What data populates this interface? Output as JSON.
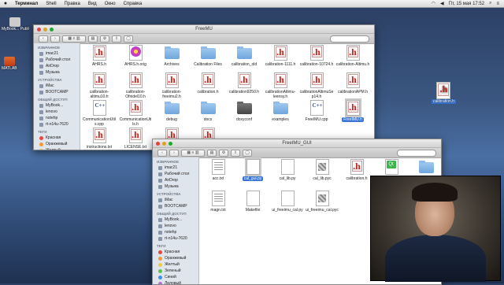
{
  "menubar": {
    "apple": "",
    "items": [
      "Терминал",
      "Shell",
      "Правка",
      "Вид",
      "Окно",
      "Справка"
    ],
    "clock": "Пт, 15 мая  17:52"
  },
  "desktop": {
    "icons": [
      {
        "label": "MyBook... Publi",
        "icon": "drive-icon"
      },
      {
        "label": "MATLAB",
        "icon": "app-icon"
      },
      {
        "label": "calibration.h",
        "icon": "h-file-icon"
      }
    ]
  },
  "window1": {
    "title": "FreeMU",
    "sidebar": {
      "sections": [
        {
          "header": "ИЗБРАННОЕ",
          "items": [
            "imac21",
            "Рабочий стол",
            "AirDrop",
            "Музыка"
          ]
        },
        {
          "header": "УСТРОЙСТВА",
          "items": [
            "iMac",
            "BOOTCAMP"
          ]
        },
        {
          "header": "ОБЩИЙ ДОСТУП",
          "items": [
            "MyBook... ",
            "lenovo",
            "notehp",
            "rt-n14u-7620"
          ]
        },
        {
          "header": "ТЕГИ",
          "items": [
            "Красная",
            "Оранжевый",
            "Желтый"
          ]
        }
      ]
    },
    "files": [
      {
        "name": "AHRS.h",
        "kind": "h"
      },
      {
        "name": "AHRS.h.orig",
        "kind": "flower"
      },
      {
        "name": "Archives",
        "kind": "folder"
      },
      {
        "name": "Calibration Files",
        "kind": "folder"
      },
      {
        "name": "calibration_old",
        "kind": "folder"
      },
      {
        "name": "calibration-1111.h",
        "kind": "h"
      },
      {
        "name": "calibration-10724.h",
        "kind": "h"
      },
      {
        "name": "calibration-Altimu.h",
        "kind": "h"
      },
      {
        "name": "calibration-altimu10.h",
        "kind": "h"
      },
      {
        "name": "calibration-Ofnidel10.h",
        "kind": "h"
      },
      {
        "name": "calibration-freeimu2.h",
        "kind": "h"
      },
      {
        "name": "calibration.h",
        "kind": "h"
      },
      {
        "name": "calibration9250.h",
        "kind": "h"
      },
      {
        "name": "calibrationAltimu-leensy.h",
        "kind": "h"
      },
      {
        "name": "calibrationAltimuSe p14.h",
        "kind": "h"
      },
      {
        "name": "calibrationAPM.h",
        "kind": "h"
      },
      {
        "name": "CommunicationUtil s.cpp",
        "kind": "cpp"
      },
      {
        "name": "CommunicationUti ls.h",
        "kind": "h"
      },
      {
        "name": "debug",
        "kind": "folder"
      },
      {
        "name": "docs",
        "kind": "folder"
      },
      {
        "name": "doxyconf",
        "kind": "dark"
      },
      {
        "name": "examples",
        "kind": "folder"
      },
      {
        "name": "FreeIMU.cpp",
        "kind": "cpp"
      },
      {
        "name": "FreeIMU.h",
        "kind": "h",
        "selected": true
      },
      {
        "name": "instructions.txt",
        "kind": "h"
      },
      {
        "name": "LICENSE.txt",
        "kind": "h"
      },
      {
        "name": "",
        "kind": "h"
      },
      {
        "name": "",
        "kind": "h"
      }
    ]
  },
  "window2": {
    "title": "FreeIMU_GUI",
    "sidebar": {
      "sections": [
        {
          "header": "ИЗБРАННОЕ",
          "items": [
            "imac21",
            "Рабочий стол",
            "AirDrop",
            "Музыка"
          ]
        },
        {
          "header": "УСТРОЙСТВА",
          "items": [
            "iMac",
            "BOOTCAMP"
          ]
        },
        {
          "header": "ОБЩИЙ ДОСТУП",
          "items": [
            "MyBook... ",
            "lenovo",
            "notehp",
            "rt-n14u-7620"
          ]
        },
        {
          "header": "ТЕГИ",
          "items": [
            "Красная",
            "Оранжевый",
            "Желтый",
            "Зеленый",
            "Синий",
            "Лиловый"
          ]
        }
      ]
    },
    "files": [
      {
        "name": "acc.txt",
        "kind": "txt"
      },
      {
        "name": "cal_gui.py",
        "kind": "blank",
        "selected": true
      },
      {
        "name": "cal_lib.py",
        "kind": "blank"
      },
      {
        "name": "cal_lib.pyc",
        "kind": "gray"
      },
      {
        "name": "calibration.h",
        "kind": "h"
      },
      {
        "name": "",
        "kind": "green"
      },
      {
        "name": "",
        "kind": "folder"
      },
      {
        "name": "magn.txt",
        "kind": "txt"
      },
      {
        "name": "Makefile",
        "kind": "blank"
      },
      {
        "name": "ui_freeimu_cal.py",
        "kind": "blank"
      },
      {
        "name": "ui_freeimu_cal.pyc",
        "kind": "gray"
      }
    ]
  }
}
